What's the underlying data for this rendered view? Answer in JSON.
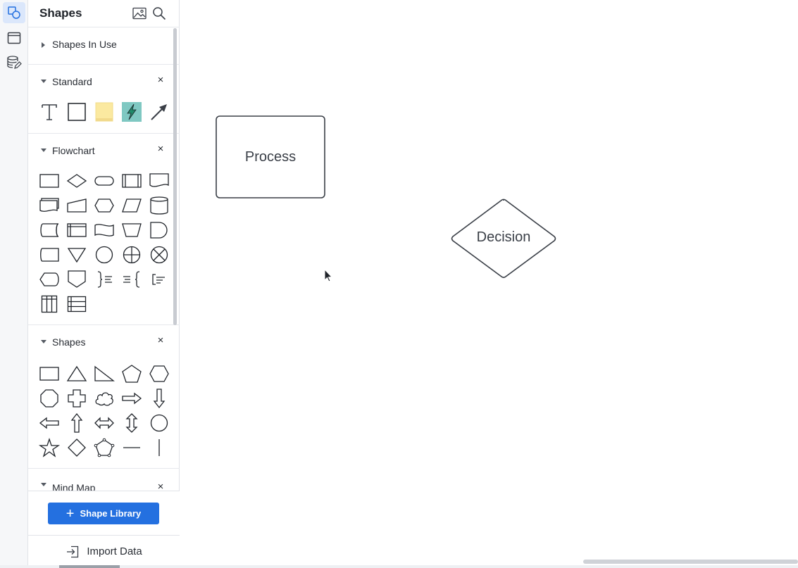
{
  "panel": {
    "title": "Shapes",
    "header_icons": [
      "image-icon",
      "search-icon"
    ]
  },
  "rail": {
    "items": [
      "shapes-icon",
      "frame-icon",
      "database-icon"
    ]
  },
  "sections": {
    "shapes_in_use": {
      "label": "Shapes In Use",
      "expanded": false
    },
    "standard": {
      "label": "Standard",
      "expanded": true,
      "close": "×",
      "items": [
        "text-icon",
        "rectangle-icon",
        "sticky-note-icon",
        "action-icon",
        "arrow-icon"
      ],
      "sticky_color": "#fbe9a0",
      "action_color": "#7fc8c2"
    },
    "flowchart": {
      "label": "Flowchart",
      "expanded": true,
      "close": "×"
    },
    "shapes": {
      "label": "Shapes",
      "expanded": true,
      "close": "×"
    },
    "mind_map": {
      "label": "Mind Map",
      "expanded": true,
      "close": "×"
    }
  },
  "footer": {
    "shape_library_label": "Shape Library",
    "shape_library_plus": "+",
    "import_label": "Import Data"
  },
  "canvas": {
    "process_label": "Process",
    "decision_label": "Decision"
  },
  "colors": {
    "accent": "#2470e0",
    "rail_active": "#dbe7fb"
  }
}
